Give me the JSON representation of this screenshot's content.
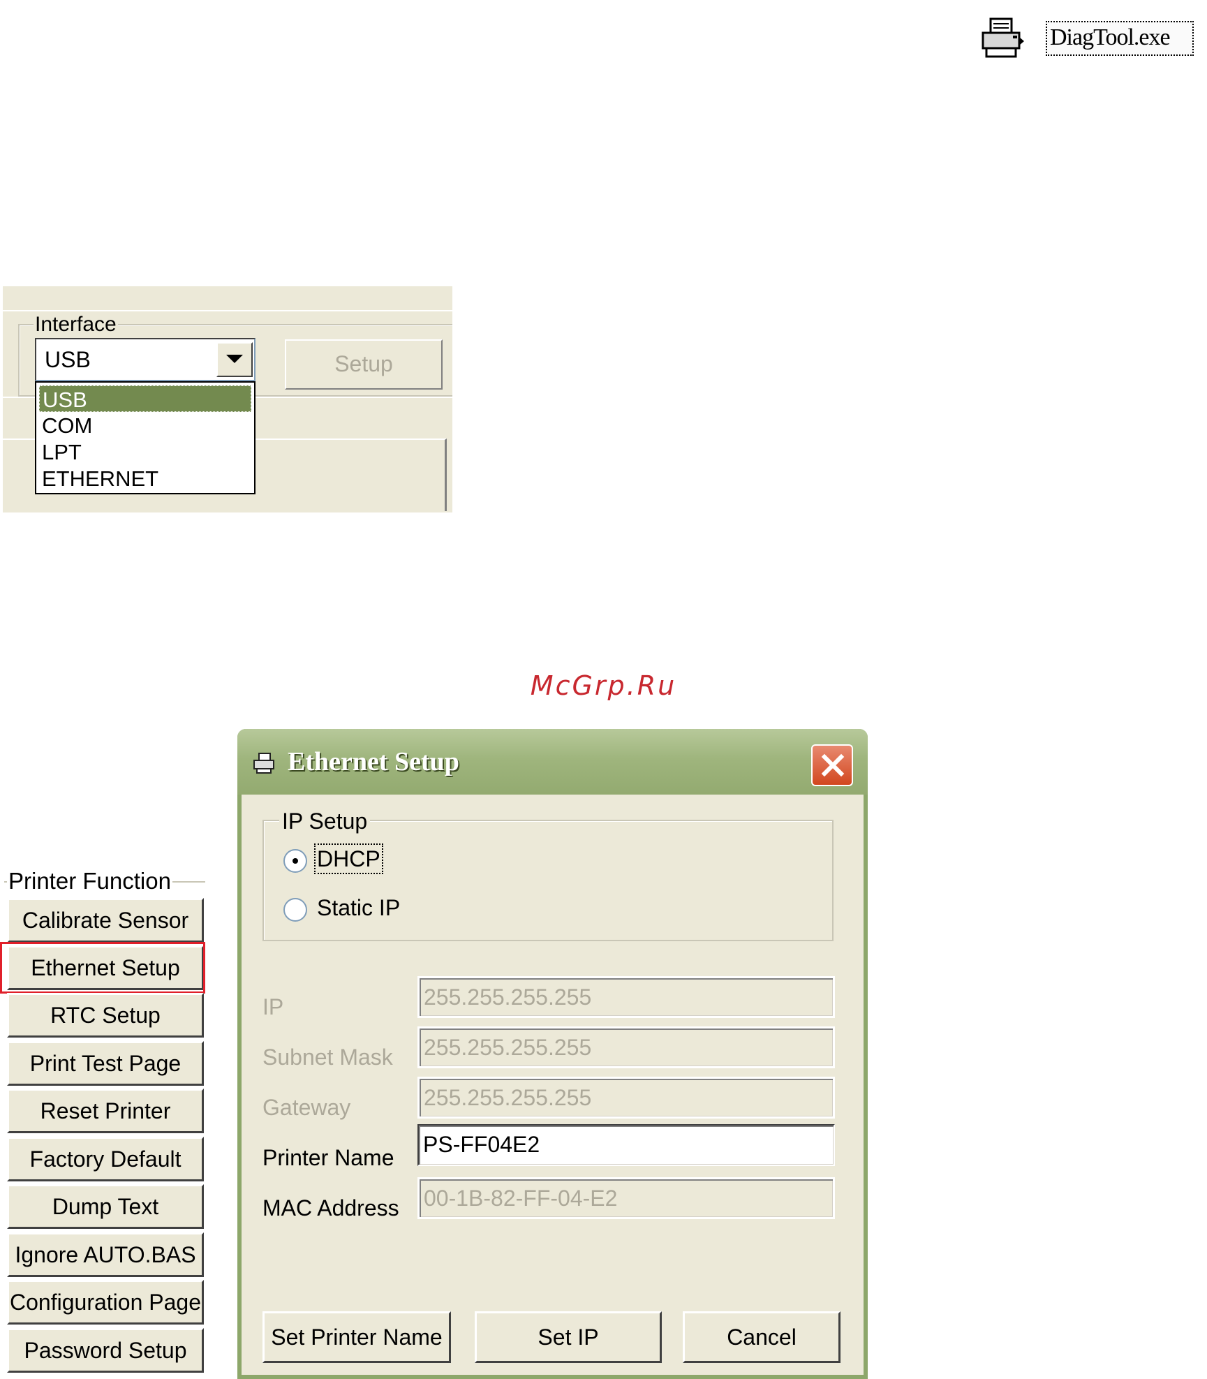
{
  "diag_icon": {
    "label": "DiagTool.exe",
    "icon": "printer-icon"
  },
  "interface_panel": {
    "group_title": "Interface",
    "selected": "USB",
    "setup_label": "Setup",
    "options": [
      "USB",
      "COM",
      "LPT",
      "ETHERNET"
    ],
    "highlighted_index": 0
  },
  "watermark": "McGrp.Ru",
  "printer_function": {
    "title": "Printer Function",
    "buttons": [
      "Calibrate Sensor",
      "Ethernet Setup",
      "RTC Setup",
      "Print Test Page",
      "Reset Printer",
      "Factory Default",
      "Dump Text",
      "Ignore AUTO.BAS",
      "Configuration Page",
      "Password Setup"
    ],
    "highlighted": "Ethernet Setup",
    "highlight_color": "#e0202a"
  },
  "ethernet_dialog": {
    "title": "Ethernet Setup",
    "ip_setup": {
      "title": "IP Setup",
      "options": [
        {
          "label": "DHCP",
          "checked": true
        },
        {
          "label": "Static IP",
          "checked": false
        }
      ]
    },
    "fields": [
      {
        "label": "IP",
        "value": "255.255.255.255",
        "enabled": false
      },
      {
        "label": "Subnet Mask",
        "value": "255.255.255.255",
        "enabled": false
      },
      {
        "label": "Gateway",
        "value": "255.255.255.255",
        "enabled": false
      },
      {
        "label": "Printer Name",
        "value": "PS-FF04E2",
        "enabled": true
      },
      {
        "label": "MAC Address",
        "value": "00-1B-82-FF-04-E2",
        "enabled": false
      }
    ],
    "buttons": {
      "set_printer_name": "Set Printer Name",
      "set_ip": "Set IP",
      "cancel": "Cancel"
    },
    "title_bar_color": "#9fb57d"
  }
}
